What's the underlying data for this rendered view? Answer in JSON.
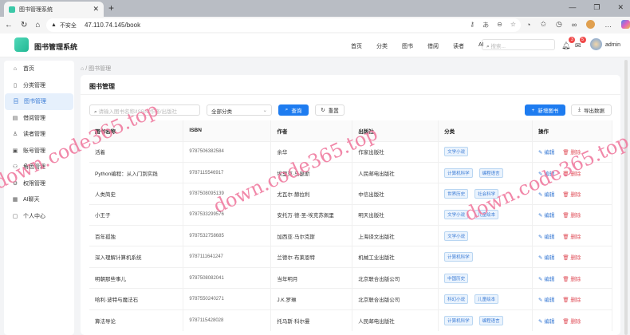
{
  "browser": {
    "tab_title": "图书管理系统",
    "url_warning": "不安全",
    "url": "47.110.74.145/book"
  },
  "app": {
    "title": "图书管理系统",
    "nav": [
      "首页",
      "分类",
      "图书",
      "借阅",
      "读者",
      "AI"
    ],
    "search_placeholder": "搜索...",
    "notifications": "3",
    "messages": "5",
    "username": "admin"
  },
  "sidebar": {
    "items": [
      {
        "label": "首页",
        "icon": "⌂"
      },
      {
        "label": "分类管理",
        "icon": "▯"
      },
      {
        "label": "图书管理",
        "icon": "目"
      },
      {
        "label": "借阅管理",
        "icon": "▤"
      },
      {
        "label": "读者管理",
        "icon": "♙"
      },
      {
        "label": "账号管理",
        "icon": "▣"
      },
      {
        "label": "角色管理",
        "icon": "⚇"
      },
      {
        "label": "权限管理",
        "icon": "⚙"
      },
      {
        "label": "AI聊天",
        "icon": "▦"
      },
      {
        "label": "个人中心",
        "icon": "▢"
      }
    ],
    "active": 2
  },
  "breadcrumb": {
    "sep": "/",
    "current": "图书管理"
  },
  "page": {
    "title": "图书管理",
    "search_placeholder": "请输入图书名称/ISBN/作者/出版社",
    "category_select": "全部分类",
    "query": "查询",
    "reset": "重置",
    "add": "新增图书",
    "export": "导出数据"
  },
  "table": {
    "headers": [
      "图书名称",
      "ISBN",
      "作者",
      "出版社",
      "分类",
      "操作"
    ],
    "edit": "编辑",
    "delete": "删除",
    "rows": [
      {
        "name": "活着",
        "isbn": "9787506382584",
        "author": "余华",
        "publisher": "作家出版社",
        "tags": [
          "文学小说"
        ]
      },
      {
        "name": "Python编程：从入门到实践",
        "isbn": "9787115546917",
        "author": "埃里克·马瑟斯",
        "publisher": "人民邮电出版社",
        "tags": [
          "计算机科学",
          "编程语言"
        ]
      },
      {
        "name": "人类简史",
        "isbn": "9787508095139",
        "author": "尤瓦尔·赫拉利",
        "publisher": "中信出版社",
        "tags": [
          "世界历史",
          "社会科学"
        ]
      },
      {
        "name": "小王子",
        "isbn": "9787533299576",
        "author": "安托万·德·圣-埃克苏佩里",
        "publisher": "明天出版社",
        "tags": [
          "文学小说",
          "儿童绘本"
        ]
      },
      {
        "name": "百年孤独",
        "isbn": "9787532758685",
        "author": "加西亚·马尔克斯",
        "publisher": "上海译文出版社",
        "tags": [
          "文学小说"
        ]
      },
      {
        "name": "深入理解计算机系统",
        "isbn": "9787111641247",
        "author": "兰德尔·布莱恩特",
        "publisher": "机械工业出版社",
        "tags": [
          "计算机科学"
        ]
      },
      {
        "name": "明朝那些事儿",
        "isbn": "9787508082041",
        "author": "当年明月",
        "publisher": "北京联合出版公司",
        "tags": [
          "中国历史"
        ]
      },
      {
        "name": "哈利·波特与魔法石",
        "isbn": "9787550240271",
        "author": "J.K.罗琳",
        "publisher": "北京联合出版公司",
        "tags": [
          "科幻小说",
          "儿童绘本"
        ]
      },
      {
        "name": "算法导论",
        "isbn": "9787115428028",
        "author": "托马斯·科尔曼",
        "publisher": "人民邮电出版社",
        "tags": [
          "计算机科学",
          "编程语言"
        ]
      }
    ]
  },
  "watermark": "down.code365.top",
  "colors": {
    "primary": "#1e7cf0",
    "danger": "#e0505a",
    "accent": "#3cc8a8"
  }
}
